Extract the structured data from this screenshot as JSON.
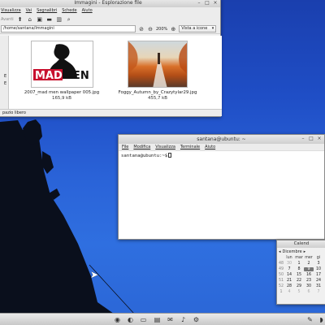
{
  "file_manager": {
    "title": "Immagini - Esplorazione file",
    "menu": [
      "Visualizza",
      "Vai",
      "Segnalibri",
      "Schede",
      "Aiuto"
    ],
    "toolbar": {
      "back_label": "Avanti"
    },
    "location": "/home/santana/Immagini",
    "zoom": "200%",
    "view_mode": "Vista a icone",
    "sidebar_letters": [
      "E",
      "E"
    ],
    "files": [
      {
        "name": "2007_mad men wallpaper 005.jpg",
        "size": "165,9 kB",
        "thumb_text_a": "MAD",
        "thumb_text_b": "MEN"
      },
      {
        "name": "Foggy_Autumn_by_Crazytylar29.jpg",
        "size": "455,7 kB"
      }
    ],
    "status": "pazio libero"
  },
  "terminal": {
    "title": "santana@ubuntu: ~",
    "menu": [
      "File",
      "Modifica",
      "Visualizza",
      "Terminale",
      "Aiuto"
    ],
    "prompt": "santana@ubuntu:~$"
  },
  "calendar": {
    "title": "Calend",
    "month": "Dicembre",
    "headers": [
      "lun",
      "mar",
      "mer",
      "gi"
    ],
    "weeks": [
      {
        "wk": "48",
        "days": [
          "30",
          "1",
          "2",
          "3"
        ]
      },
      {
        "wk": "49",
        "days": [
          "7",
          "8",
          "9",
          "10"
        ]
      },
      {
        "wk": "50",
        "days": [
          "14",
          "15",
          "16",
          "17"
        ]
      },
      {
        "wk": "51",
        "days": [
          "21",
          "22",
          "23",
          "24"
        ]
      },
      {
        "wk": "52",
        "days": [
          "28",
          "29",
          "30",
          "31"
        ]
      },
      {
        "wk": "1",
        "days": [
          "4",
          "5",
          "6",
          "7"
        ]
      }
    ],
    "selected": "9"
  },
  "colors": {
    "desktop_top": "#1a3fae",
    "desktop_bottom": "#2f6fe0",
    "window_chrome": "#ececec"
  }
}
